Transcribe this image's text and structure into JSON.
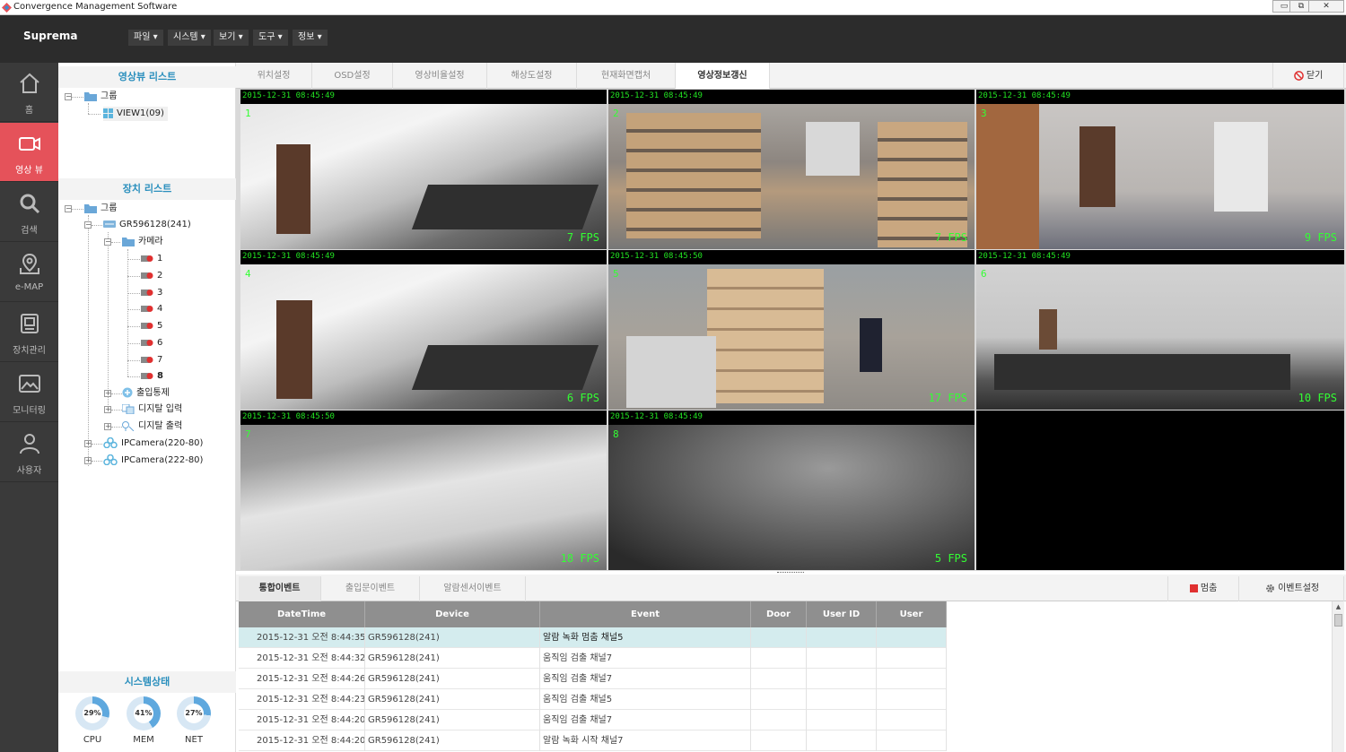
{
  "window": {
    "title": "Convergence Management Software",
    "min": "▭",
    "max": "⧉",
    "close": "✕"
  },
  "app": {
    "brand": "Suprema",
    "menus": [
      "파일 ▾",
      "시스템 ▾",
      "보기 ▾",
      "도구 ▾",
      "정보 ▾"
    ]
  },
  "nav": [
    {
      "label": "홈",
      "icon": "home-icon"
    },
    {
      "label": "영상 뷰",
      "icon": "camera-icon"
    },
    {
      "label": "검색",
      "icon": "search-icon"
    },
    {
      "label": "e-MAP",
      "icon": "map-pin-icon"
    },
    {
      "label": "장치관리",
      "icon": "device-icon"
    },
    {
      "label": "모니터링",
      "icon": "image-icon"
    },
    {
      "label": "사용자",
      "icon": "user-icon"
    }
  ],
  "viewlist": {
    "title": "영상뷰 리스트",
    "group": "그룹",
    "view": "VIEW1(09)"
  },
  "devicelist": {
    "title": "장치 리스트",
    "group": "그룹",
    "device": "GR596128(241)",
    "camera": "카메라",
    "channels": [
      "1",
      "2",
      "3",
      "4",
      "5",
      "6",
      "7",
      "8"
    ],
    "access": "출입통제",
    "din": "디지탈 입력",
    "dout": "디지탈 출력",
    "ipcams": [
      "IPCamera(220-80)",
      "IPCamera(222-80)"
    ]
  },
  "system": {
    "title": "시스템상태",
    "gauges": [
      {
        "label": "CPU",
        "value": "29%",
        "pct": 29
      },
      {
        "label": "MEM",
        "value": "41%",
        "pct": 41
      },
      {
        "label": "NET",
        "value": "27%",
        "pct": 27
      }
    ]
  },
  "viewtabs": [
    "위치설정",
    "OSD설정",
    "영상비율설정",
    "해상도설정",
    "현재화면캡처",
    "영상정보갱신"
  ],
  "close_label": "닫기",
  "cameras": [
    {
      "ts": "2015-12-31 08:45:49",
      "num": "1",
      "fps": "7 FPS"
    },
    {
      "ts": "2015-12-31 08:45:49",
      "num": "2",
      "fps": "7 FPS"
    },
    {
      "ts": "2015-12-31 08:45:49",
      "num": "3",
      "fps": "9 FPS"
    },
    {
      "ts": "2015-12-31 08:45:49",
      "num": "4",
      "fps": "6 FPS"
    },
    {
      "ts": "2015-12-31 08:45:50",
      "num": "5",
      "fps": "17 FPS"
    },
    {
      "ts": "2015-12-31 08:45:49",
      "num": "6",
      "fps": "10 FPS"
    },
    {
      "ts": "2015-12-31 08:45:50",
      "num": "7",
      "fps": "18 FPS"
    },
    {
      "ts": "2015-12-31 08:45:49",
      "num": "8",
      "fps": "5 FPS"
    }
  ],
  "eventtabs": [
    "통합이벤트",
    "출입문이벤트",
    "알람센서이벤트"
  ],
  "stop_label": "멈춤",
  "eventsettings_label": "이벤트설정",
  "events": {
    "columns": [
      "DateTime",
      "Device",
      "Event",
      "Door",
      "User ID",
      "User"
    ],
    "rows": [
      [
        "2015-12-31 오전 8:44:35",
        "GR596128(241)",
        "알람 녹화 멈춤 채널5",
        "",
        "",
        ""
      ],
      [
        "2015-12-31 오전 8:44:32",
        "GR596128(241)",
        "움직임 검출 채널7",
        "",
        "",
        ""
      ],
      [
        "2015-12-31 오전 8:44:26",
        "GR596128(241)",
        "움직임 검출 채널7",
        "",
        "",
        ""
      ],
      [
        "2015-12-31 오전 8:44:23",
        "GR596128(241)",
        "움직임 검출 채널5",
        "",
        "",
        ""
      ],
      [
        "2015-12-31 오전 8:44:20",
        "GR596128(241)",
        "움직임 검출 채널7",
        "",
        "",
        ""
      ],
      [
        "2015-12-31 오전 8:44:20",
        "GR596128(241)",
        "알람 녹화 시작 채널7",
        "",
        "",
        ""
      ]
    ]
  },
  "colors": {
    "accent": "#e5525a",
    "header_text": "#2a8fbd",
    "osd_green": "#33ff33"
  }
}
